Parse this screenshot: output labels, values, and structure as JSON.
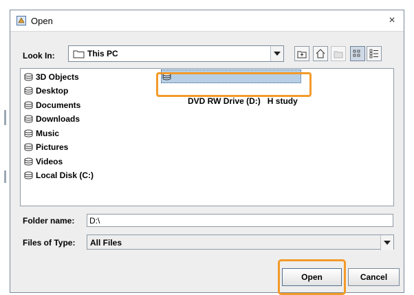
{
  "window": {
    "title": "Open",
    "close_glyph": "×"
  },
  "look_in": {
    "label": "Look In:",
    "value": "This PC"
  },
  "toolbar": {
    "buttons": [
      {
        "name": "up-one-level-icon"
      },
      {
        "name": "home-icon"
      },
      {
        "name": "new-folder-icon",
        "enabled": false
      },
      {
        "name": "list-view-icon",
        "pressed": true
      },
      {
        "name": "details-view-icon"
      }
    ]
  },
  "files": [
    {
      "label": "3D Objects"
    },
    {
      "label": "Desktop"
    },
    {
      "label": "Documents"
    },
    {
      "label": "Downloads"
    },
    {
      "label": "Music"
    },
    {
      "label": "Pictures"
    },
    {
      "label": "Videos"
    },
    {
      "label": "Local Disk (C:)"
    },
    {
      "label": "DVD RW Drive (D:)   H study",
      "selected": true
    }
  ],
  "folder_name": {
    "label": "Folder name:",
    "value": "D:\\"
  },
  "files_of_type": {
    "label": "Files of Type:",
    "value": "All Files"
  },
  "buttons": {
    "open": "Open",
    "cancel": "Cancel"
  },
  "colors": {
    "highlight": "#f39a29",
    "selection": "#b8cfe5"
  }
}
